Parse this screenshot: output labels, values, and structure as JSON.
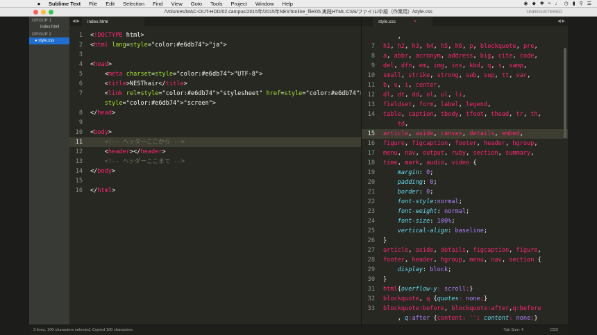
{
  "menubar": {
    "apple": "",
    "items": [
      "Sublime Text",
      "File",
      "Edit",
      "Selection",
      "Find",
      "View",
      "Goto",
      "Tools",
      "Project",
      "Window",
      "Help"
    ]
  },
  "titlebar": {
    "title": "/Volumes/MAC-OUT-HDD/02.campus/2015年/2015年NESTonline_file/05.実践HTML:CSS/ファイル/中級（作業用）/style.css",
    "unregistered": "UNREGISTERED"
  },
  "sidebar": {
    "group1": "GROUP 1",
    "group1_file": "index.html",
    "group2": "GROUP 2",
    "group2_file": "style.css"
  },
  "pane1": {
    "tab": "index.html",
    "nav": "◀ ▶",
    "lines": [
      {
        "n": "1",
        "text": "<!DOCTYPE html>"
      },
      {
        "n": "2",
        "text": "<html lang=\"ja\">"
      },
      {
        "n": "3",
        "text": ""
      },
      {
        "n": "4",
        "text": "<head>"
      },
      {
        "n": "5",
        "text": "    <meta charset=\"UTF-8\">"
      },
      {
        "n": "6",
        "text": "    <title>NESThair</title>"
      },
      {
        "n": "7",
        "text": "    <link rel=\"stylesheet\" href=\"style.css\" type=\"text/css\" media="
      },
      {
        "n": "",
        "text": "    \"screen\">"
      },
      {
        "n": "8",
        "text": "</head>"
      },
      {
        "n": "9",
        "text": ""
      },
      {
        "n": "10",
        "text": "<body>"
      },
      {
        "n": "11",
        "text": "    <!-- ヘッダーここから -->"
      },
      {
        "n": "12",
        "text": "    <header></header>"
      },
      {
        "n": "13",
        "text": "    <!-- ヘッダーここまで -->"
      },
      {
        "n": "14",
        "text": "</body>"
      },
      {
        "n": "15",
        "text": ""
      },
      {
        "n": "16",
        "text": "</html>"
      }
    ]
  },
  "pane2": {
    "tab": "style.css",
    "close": "×",
    "nav": "◀ ▶",
    "lines": [
      {
        "n": "",
        "text": "    ,"
      },
      {
        "n": "7",
        "text": "h1, h2, h3, h4, h5, h6, p, blockquote, pre,"
      },
      {
        "n": "8",
        "text": "a, abbr, acronym, address, big, cite, code,"
      },
      {
        "n": "9",
        "text": "del, dfn, em, img, ins, kbd, q, s, samp,"
      },
      {
        "n": "10",
        "text": "small, strike, strong, sub, sup, tt, var,"
      },
      {
        "n": "11",
        "text": "b, u, i, center,"
      },
      {
        "n": "12",
        "text": "dl, dt, dd, ol, ul, li,"
      },
      {
        "n": "13",
        "text": "fieldset, form, label, legend,"
      },
      {
        "n": "14",
        "text": "table, caption, tbody, tfoot, thead, tr, th,"
      },
      {
        "n": "",
        "text": "    td,"
      },
      {
        "n": "15",
        "text": "article, aside, canvas, details, embed,"
      },
      {
        "n": "16",
        "text": "figure, figcaption, footer, header, hgroup,"
      },
      {
        "n": "17",
        "text": "menu, nav, output, ruby, section, summary,"
      },
      {
        "n": "18",
        "text": "time, mark, audio, video {"
      },
      {
        "n": "19",
        "text": "    margin: 0;"
      },
      {
        "n": "20",
        "text": "    padding: 0;"
      },
      {
        "n": "21",
        "text": "    border: 0;"
      },
      {
        "n": "22",
        "text": "    font-style:normal;"
      },
      {
        "n": "23",
        "text": "    font-weight: normal;"
      },
      {
        "n": "24",
        "text": "    font-size: 100%;"
      },
      {
        "n": "25",
        "text": "    vertical-align: baseline;"
      },
      {
        "n": "26",
        "text": "}"
      },
      {
        "n": "27",
        "text": "article, aside, details, figcaption, figure,"
      },
      {
        "n": "28",
        "text": "footer, header, hgroup, menu, nav, section {"
      },
      {
        "n": "29",
        "text": "    display: block;"
      },
      {
        "n": "30",
        "text": "}"
      },
      {
        "n": "31",
        "text": "html{overflow-y: scroll;}"
      },
      {
        "n": "32",
        "text": "blockquote, q {quotes: none;}"
      },
      {
        "n": "33",
        "text": "blockquote:before, blockquote:after,q:before"
      },
      {
        "n": "",
        "text": "    , q:after {content: ''; content: none;}"
      }
    ]
  },
  "statusbar": {
    "message": "3 lines, 100 characters selected; Copied 100 characters",
    "tab_size": "Tab Size: 4",
    "syntax": "CSS"
  },
  "colors": {
    "tag": "#f92672",
    "attr": "#a6e22e",
    "string": "#e6db74",
    "comment": "#75715e",
    "property": "#66d9ef",
    "number": "#ae81ff",
    "plain": "#f8f8f2"
  }
}
